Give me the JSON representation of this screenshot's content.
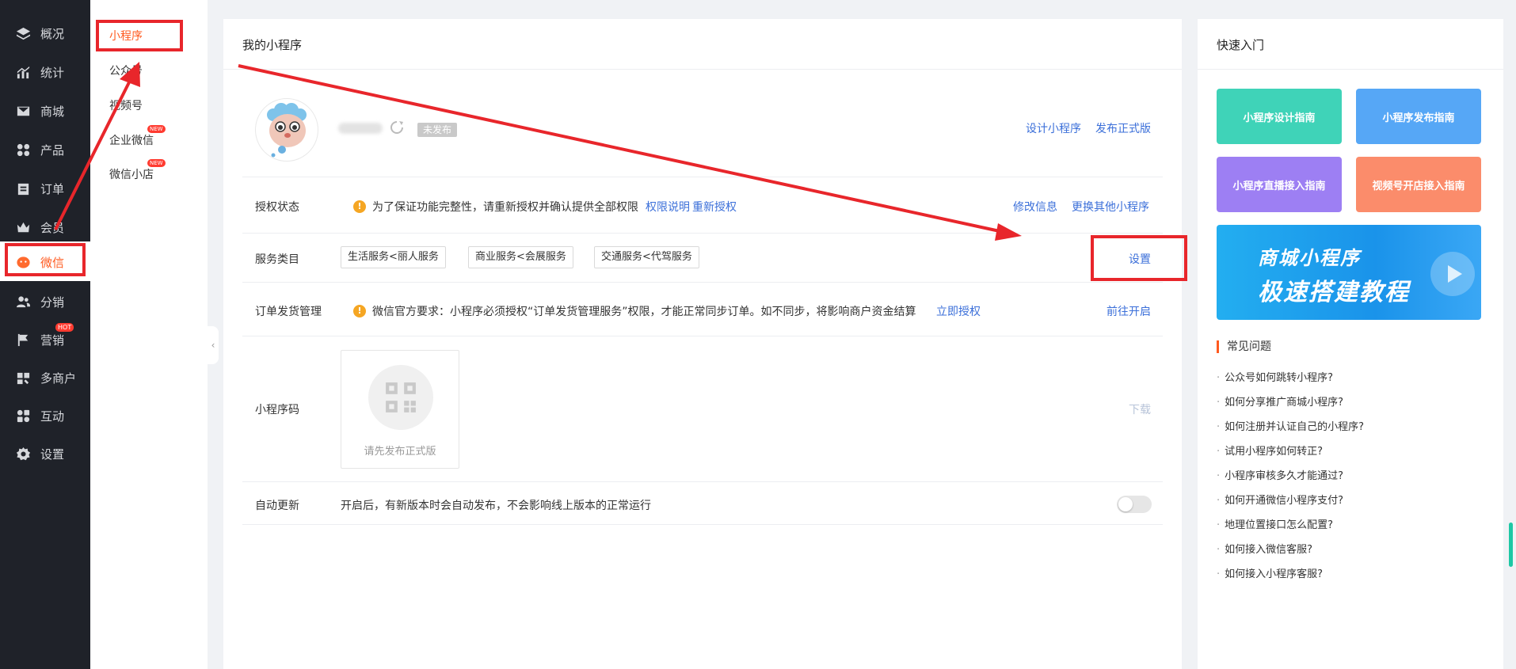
{
  "sidebar": {
    "items": [
      {
        "label": "概况",
        "icon": "layers-icon"
      },
      {
        "label": "统计",
        "icon": "chart-icon"
      },
      {
        "label": "商城",
        "icon": "mail-icon"
      },
      {
        "label": "产品",
        "icon": "grid-icon"
      },
      {
        "label": "订单",
        "icon": "order-icon"
      },
      {
        "label": "会员",
        "icon": "crown-icon"
      },
      {
        "label": "微信",
        "icon": "wechat-icon"
      },
      {
        "label": "分销",
        "icon": "users-icon"
      },
      {
        "label": "营销",
        "icon": "flag-icon",
        "badge": "HOT"
      },
      {
        "label": "多商户",
        "icon": "store-icon"
      },
      {
        "label": "互动",
        "icon": "interact-icon"
      },
      {
        "label": "设置",
        "icon": "gear-icon"
      }
    ],
    "active_index": 6,
    "accent": "#ff5a1f"
  },
  "subnav": {
    "items": [
      {
        "label": "小程序"
      },
      {
        "label": "公众号"
      },
      {
        "label": "视频号"
      },
      {
        "label": "企业微信",
        "badge": "NEW"
      },
      {
        "label": "微信小店",
        "badge": "NEW"
      }
    ],
    "collapse_icon": "‹"
  },
  "main": {
    "title": "我的小程序",
    "status": "未发布",
    "actions": {
      "design": "设计小程序",
      "publish": "发布正式版"
    },
    "auth": {
      "label": "授权状态",
      "message": "为了保证功能完整性，请重新授权并确认提供全部权限",
      "link1": "权限说明",
      "link2": "重新授权",
      "right1": "修改信息",
      "right2": "更换其他小程序"
    },
    "service": {
      "label": "服务类目",
      "chips": [
        "生活服务<丽人服务",
        "商业服务<会展服务",
        "交通服务<代驾服务"
      ],
      "action": "设置"
    },
    "shipping": {
      "label": "订单发货管理",
      "message": "微信官方要求：小程序必须授权“订单发货管理服务”权限，才能正常同步订单。如不同步，将影响商户资金结算",
      "link": "立即授权",
      "action": "前往开启"
    },
    "qrcode": {
      "label": "小程序码",
      "placeholder": "请先发布正式版",
      "download": "下载"
    },
    "autoupdate": {
      "label": "自动更新",
      "message": "开启后，有新版本时会自动发布，不会影响线上版本的正常运行",
      "enabled": false
    }
  },
  "quick": {
    "title": "快速入门",
    "cards": [
      {
        "label": "小程序设计指南",
        "color": "#3fd3b8"
      },
      {
        "label": "小程序发布指南",
        "color": "#56a7f6"
      },
      {
        "label": "小程序直播接入指南",
        "color": "#9d7ff3"
      },
      {
        "label": "视频号开店接入指南",
        "color": "#fb8c6b"
      }
    ],
    "banner": {
      "line1": "商城小程序",
      "line2": "极速搭建教程"
    },
    "faq_title": "常见问题",
    "faq": [
      "公众号如何跳转小程序?",
      "如何分享推广商城小程序?",
      "如何注册并认证自己的小程序?",
      "试用小程序如何转正?",
      "小程序审核多久才能通过?",
      "如何开通微信小程序支付?",
      "地理位置接口怎么配置?",
      "如何接入微信客服?",
      "如何接入小程序客服?"
    ]
  },
  "annotation_color": "#e8262b"
}
